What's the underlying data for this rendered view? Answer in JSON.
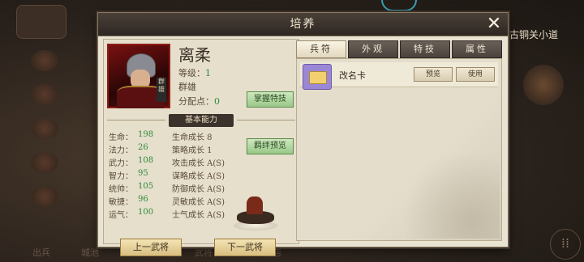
{
  "background": {
    "top_right_text": "古铜关小道",
    "left_menu": [
      "",
      "",
      "",
      "",
      "",
      ""
    ],
    "bottom_bar": [
      "出兵",
      "城池",
      "学院",
      "装备",
      "武将",
      "会盟",
      "商店"
    ],
    "menu_icon": "grid-icon"
  },
  "dialog": {
    "title": "培养",
    "close_icon": "close-icon"
  },
  "hero": {
    "name": "离柔",
    "level_label": "等级：",
    "level_value": "1",
    "faction": "群雄",
    "points_label": "分配点：",
    "points_value": "0",
    "portrait_tag": "群雄",
    "skill_button": "掌握特技",
    "section_title": "基本能力",
    "bond_button": "羁绊预览",
    "stats": [
      {
        "label": "生命：",
        "value": "198",
        "growth": "生命成长 8"
      },
      {
        "label": "法力：",
        "value": "26",
        "growth": "策略成长 1"
      },
      {
        "label": "武力：",
        "value": "108",
        "growth": "攻击成长 A(S)"
      },
      {
        "label": "智力：",
        "value": "95",
        "growth": "谋略成长 A(S)"
      },
      {
        "label": "统帅：",
        "value": "105",
        "growth": "防御成长 A(S)"
      },
      {
        "label": "敏捷：",
        "value": "96",
        "growth": "灵敏成长 A(S)"
      },
      {
        "label": "运气：",
        "value": "100",
        "growth": "士气成长 A(S)"
      }
    ],
    "prev_button": "上一武将",
    "next_button": "下一武将"
  },
  "tabs": [
    "兵符",
    "外观",
    "特技",
    "属性"
  ],
  "active_tab": 0,
  "items": [
    {
      "name": "改名卡",
      "preview_label": "预览",
      "use_label": "使用"
    }
  ]
}
